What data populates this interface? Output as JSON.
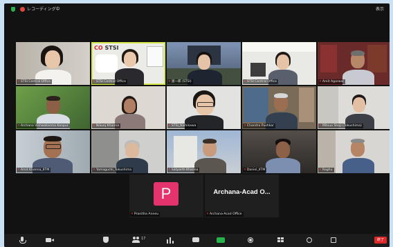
{
  "app": {
    "recording_label": "レコーディング中",
    "view_label": "表示"
  },
  "participants": {
    "p1": "STSI Central Office",
    "p2": "STSI Central Office",
    "p3": "渡一郎 (STSI)",
    "p4": "STSI Central Office",
    "p5": "Amit Agarwal",
    "p6": "Archana Vishwakarma Kanpur",
    "p7": "Nikunj Khanna",
    "p8": "STSI_Nishikawa",
    "p9": "Chandra Pushkar",
    "p10": "Mitsuo Shoji (Tokushima)",
    "p11": "Amit Khanna_IITM",
    "p12": "Yamaguchi_Tokushima",
    "p13": "Satyarth Khanna",
    "p14": "Daniel_IITM",
    "p15": "Raghu",
    "p16": "Pranitha Anneu",
    "p17": "Archana-Acad Office"
  },
  "tiles": {
    "logo_text": "STSI",
    "avatar_letter": "P",
    "archana_display": "Archana-Acad O..."
  },
  "colors": {
    "accent_active_border": "#d7e84a",
    "mute_icon": "#ff4a4a",
    "avatar_bg": "#e5336d",
    "end_button": "#e02828"
  },
  "toolbar": {
    "icons": [
      "microphone-icon",
      "video-icon",
      "security-icon",
      "participants-icon",
      "polls-icon",
      "chat-icon",
      "share-screen-icon",
      "record-icon",
      "breakout-rooms-icon",
      "reactions-icon",
      "apps-icon"
    ],
    "participant_count": "17",
    "end_label": "終了"
  }
}
